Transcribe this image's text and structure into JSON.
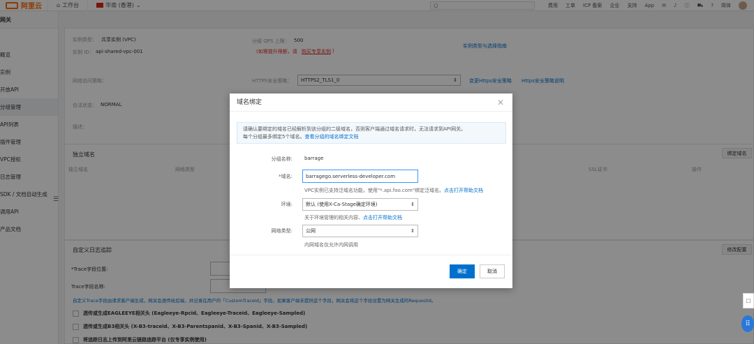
{
  "topbar": {
    "logo": "阿里云",
    "workbench": "工作台",
    "region": "华南 (香港)",
    "search_placeholder": "Q",
    "menu": [
      "费用",
      "工单",
      "ICP 备案",
      "企业",
      "支持",
      "App"
    ],
    "lang": "简体"
  },
  "sidebar": {
    "header": "网关",
    "items": [
      {
        "label": "概览"
      },
      {
        "label": "实例"
      },
      {
        "label": "开放API"
      },
      {
        "label": "分组管理"
      },
      {
        "label": "API列表"
      },
      {
        "label": "插件管理"
      },
      {
        "label": "VPC授权"
      },
      {
        "label": "日志管理"
      },
      {
        "label": "SDK / 文档自动生成"
      },
      {
        "label": "调用API"
      },
      {
        "label": "产品文档"
      }
    ],
    "collapse_icon": "☰"
  },
  "main": {
    "instance_type_label": "实例类型：",
    "instance_type_value": "共享实例 (VPC)",
    "instance_id_label": "实例 ID：",
    "instance_id_value": "api-shared-vpc-001",
    "qps_label": "分组 QPS 上限：",
    "qps_value": "500",
    "qps_note": "(如需提升限额，请",
    "qps_note_link": "购买专享实例",
    "qps_note_end": ")",
    "instance_guide_link": "实例类型与选择指南",
    "net_policy_label": "网络访问策略：",
    "https_label": "HTTPS安全策略：",
    "https_value": "HTTPS2_TLS1_0",
    "change_https_link": "变更Https安全策略",
    "https_doc_link": "Https安全策略说明",
    "audit_label": "合法状态：",
    "audit_value": "NORMAL",
    "desc_label": "描述：",
    "domain_section_title": "独立域名",
    "bind_domain_button": "绑定域名",
    "domain_table_headers": [
      "独立域名",
      "网络类型",
      "SSL证书",
      "操作"
    ],
    "trace_section_title": "自定义日志追踪",
    "modify_config_button": "修改配置",
    "trace_pos_label": "*Trace字段位置:",
    "trace_name_label": "Trace字段名称:",
    "trace_desc": "自定义Trace字段由请求客户端生成，网关会透传给后端，并记录在用户的「CustomTraceId」字段。如果客户端未提供这个字段，网关会将这个字段设置为网关生成的RequestId。",
    "checkbox_1": "透传或生成EAGLEEYE相关头 (Eagleeye-Rpcid、Eagleeye-Traceid、Eagleeye-Sampled)",
    "checkbox_2": "透传或生成B3相关头 (X-B3-traceid、X-B3-Parentspanid、X-B3-Spanid、X-B3-Sampled)",
    "checkbox_3": "将追踪日志上传到阿里云链路追踪平台 (仅专享实例使用)"
  },
  "modal": {
    "title": "域名绑定",
    "notice_line1": "请确认要绑定的域名已经解析到该分组的二级域名，否则客户端通过域名请求时，无法请求到API网关。",
    "notice_line2": "每个分组最多绑定5个域名。",
    "notice_link": "查看分组的域名绑定文档",
    "group_label": "分组名称:",
    "group_value": "barrage",
    "domain_label": "*域名:",
    "domain_value": "barragego.serverless-developer.com",
    "domain_help": "VPC实例已支持泛域名功能，使用\"*.api.foo.com\"绑定泛域名。",
    "domain_help_link": "点击打开帮助文档",
    "env_label": "环境:",
    "env_value": "默认 (使用X-Ca-Stage确定环境)",
    "env_help": "关于环境管理的相关内容、",
    "env_help_link": "点击打开帮助文档",
    "net_label": "网络类型:",
    "net_value": "公网",
    "net_help": "内网域名仅允许内网调用",
    "ok_button": "确定",
    "cancel_button": "取消"
  },
  "colors": {
    "accent": "#0070cc",
    "brand": "#ff6a00"
  }
}
